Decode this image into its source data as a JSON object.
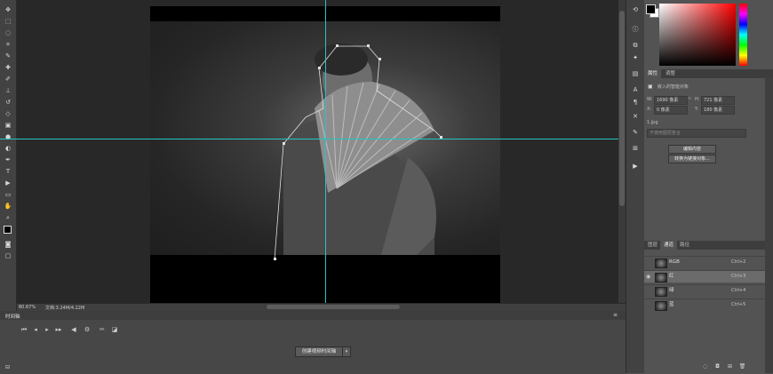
{
  "status": {
    "zoom": "80.67%",
    "doc_size": "文档:3.24M/4.22M"
  },
  "timeline": {
    "tab": "时间轴",
    "create_button": "创建视频时间轴"
  },
  "properties": {
    "tab_properties": "属性",
    "tab_adjust": "调整",
    "object_type": "嵌入的智能对象",
    "w_label": "W:",
    "w_value": "1690 像素",
    "h_label": "H:",
    "h_value": "721 像素",
    "x_label": "X:",
    "x_value": "0 像素",
    "y_label": "Y:",
    "y_value": "180 像素",
    "filename": "1.jpg",
    "comp_placeholder": "不使用图层复合",
    "edit_button": "编辑内容",
    "convert_button": "转换为链接对象..."
  },
  "channels": {
    "tab_layers": "图层",
    "tab_channels": "通道",
    "tab_paths": "路径",
    "rows": [
      {
        "name": "RGB",
        "shortcut": "Ctrl+2"
      },
      {
        "name": "红",
        "shortcut": "Ctrl+3"
      },
      {
        "name": "绿",
        "shortcut": "Ctrl+4"
      },
      {
        "name": "蓝",
        "shortcut": "Ctrl+5"
      }
    ]
  },
  "colors": {
    "guide": "#27c4c4",
    "foreground": "#000000",
    "background": "#ffffff"
  }
}
